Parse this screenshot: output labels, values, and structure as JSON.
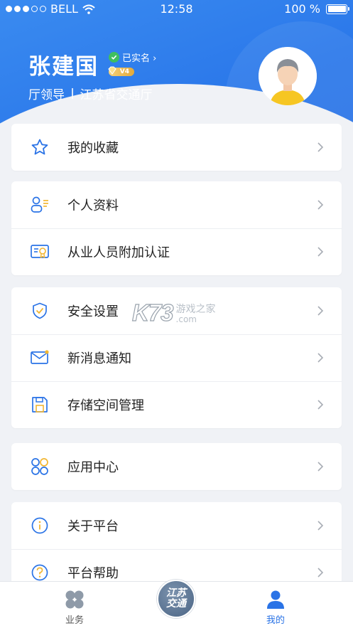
{
  "statusbar": {
    "carrier": "BELL",
    "time": "12:58",
    "battery": "100 %"
  },
  "profile": {
    "name": "张建国",
    "verified_label": "已实名 ›",
    "vip_level": "V4",
    "role": "厅领导",
    "organization": "江苏省交通厅"
  },
  "menu": {
    "favorites": "我的收藏",
    "personal_info": "个人资料",
    "practitioner_auth": "从业人员附加认证",
    "security": "安全设置",
    "notifications": "新消息通知",
    "storage": "存储空间管理",
    "app_center": "应用中心",
    "about": "关于平台",
    "help": "平台帮助"
  },
  "watermark": {
    "main": "K73",
    "cn": "游戏之家",
    "domain": ".com"
  },
  "tabbar": {
    "business": "业务",
    "center_logo": "江苏交通",
    "center_logo_line1": "江苏",
    "center_logo_line2": "交通",
    "mine": "我的"
  },
  "colors": {
    "primary": "#2a73e6",
    "verified_green": "#3fbf5f",
    "vip_gold": "#e2a93a",
    "icon_yellow": "#f2b632"
  }
}
